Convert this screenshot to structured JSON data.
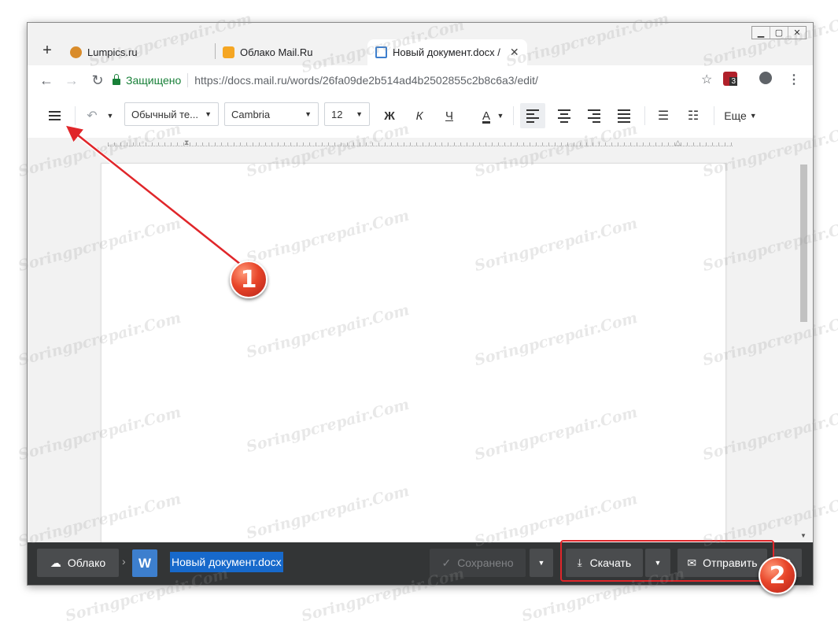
{
  "browser": {
    "tabs": [
      {
        "label": "Lumpics.ru",
        "favicon_color": "#d98c2b"
      },
      {
        "label": "Облако Mail.Ru",
        "favicon_color": "#f5a623"
      },
      {
        "label": "Новый документ.docx /",
        "favicon_color": "#3d7fce"
      }
    ],
    "new_tab_label": "+",
    "close_tab": "✕",
    "secure_label": "Защищено",
    "url": "https://docs.mail.ru/words/26fa09de2b514ad4b2502855c2b8c6a3/edit/",
    "extension_badge": "3"
  },
  "toolbar": {
    "style_select": "Обычный те...",
    "font_select": "Cambria",
    "size_select": "12",
    "bold": "Ж",
    "italic": "К",
    "underline": "Ч",
    "font_color": "A",
    "more": "Еще"
  },
  "bottom_bar": {
    "cloud_button": "Облако",
    "file_type_icon": "W",
    "file_name": "Новый документ.docx",
    "saved_label": "Сохранено",
    "download_button": "Скачать",
    "send_button": "Отправить"
  },
  "annotations": {
    "badge_1": "1",
    "badge_2": "2"
  },
  "watermark": "Soringpcrepair.Com",
  "colors": {
    "secure_green": "#188038",
    "bottom_bar_bg": "#333536",
    "filename_highlight": "#1769cb",
    "annotation_red": "#e0262a"
  }
}
